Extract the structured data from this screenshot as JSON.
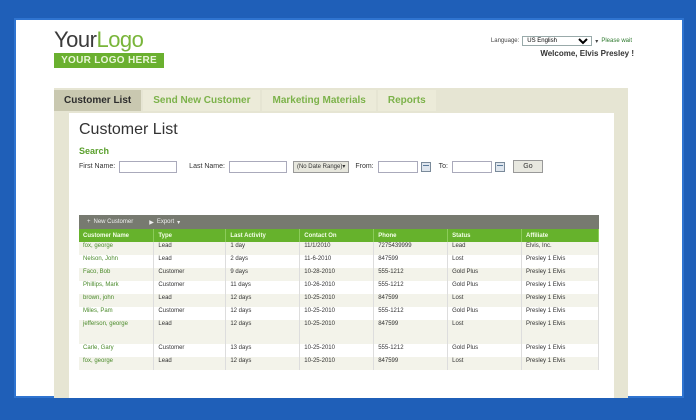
{
  "logo": {
    "part1": "Your",
    "part2": "Logo",
    "tagline": "YOUR LOGO HERE"
  },
  "header": {
    "language_label": "Language:",
    "language_value": "US English",
    "language_link": "Please wait",
    "welcome": "Welcome, Elvis Presley !"
  },
  "tabs": [
    {
      "label": "Customer List"
    },
    {
      "label": "Send New Customer"
    },
    {
      "label": "Marketing Materials"
    },
    {
      "label": "Reports"
    }
  ],
  "page": {
    "title": "Customer List",
    "search_label": "Search"
  },
  "filters": {
    "first_name_label": "First Name:",
    "last_name_label": "Last Name:",
    "date_select": "(No Date Range)",
    "from_label": "From:",
    "to_label": "To:",
    "go_label": "Go"
  },
  "toolbar": {
    "new_customer": "New Customer",
    "export": "Export"
  },
  "table": {
    "columns": [
      "Customer Name",
      "Type",
      "Last Activity",
      "Contact On",
      "Phone",
      "Status",
      "Affiliate"
    ],
    "rows": [
      [
        "fox, george",
        "Lead",
        "1 day",
        "11/1/2010",
        "7275439999",
        "Lead",
        "Elvis, Inc."
      ],
      [
        "Nelson, John",
        "Lead",
        "2 days",
        "11-6-2010",
        "847599",
        "Lost",
        "Presley 1 Elvis"
      ],
      [
        "Faco, Bob",
        "Customer",
        "9 days",
        "10-28-2010",
        "555-1212",
        "Gold Plus",
        "Presley 1 Elvis"
      ],
      [
        "Phillips, Mark",
        "Customer",
        "11 days",
        "10-26-2010",
        "555-1212",
        "Gold Plus",
        "Presley 1 Elvis"
      ],
      [
        "brown, john",
        "Lead",
        "12 days",
        "10-25-2010",
        "847599",
        "Lost",
        "Presley 1 Elvis"
      ],
      [
        "Miles, Pam",
        "Customer",
        "12 days",
        "10-25-2010",
        "555-1212",
        "Gold Plus",
        "Presley 1 Elvis"
      ],
      [
        "jefferson, george",
        "Lead",
        "12 days",
        "10-25-2010",
        "847599",
        "Lost",
        "Presley 1 Elvis"
      ],
      [
        "Carle, Gary",
        "Customer",
        "13 days",
        "10-25-2010",
        "555-1212",
        "Gold Plus",
        "Presley 1 Elvis"
      ],
      [
        "fox, george",
        "Lead",
        "12 days",
        "10-25-2010",
        "847599",
        "Lost",
        "Presley 1 Elvis"
      ]
    ]
  }
}
